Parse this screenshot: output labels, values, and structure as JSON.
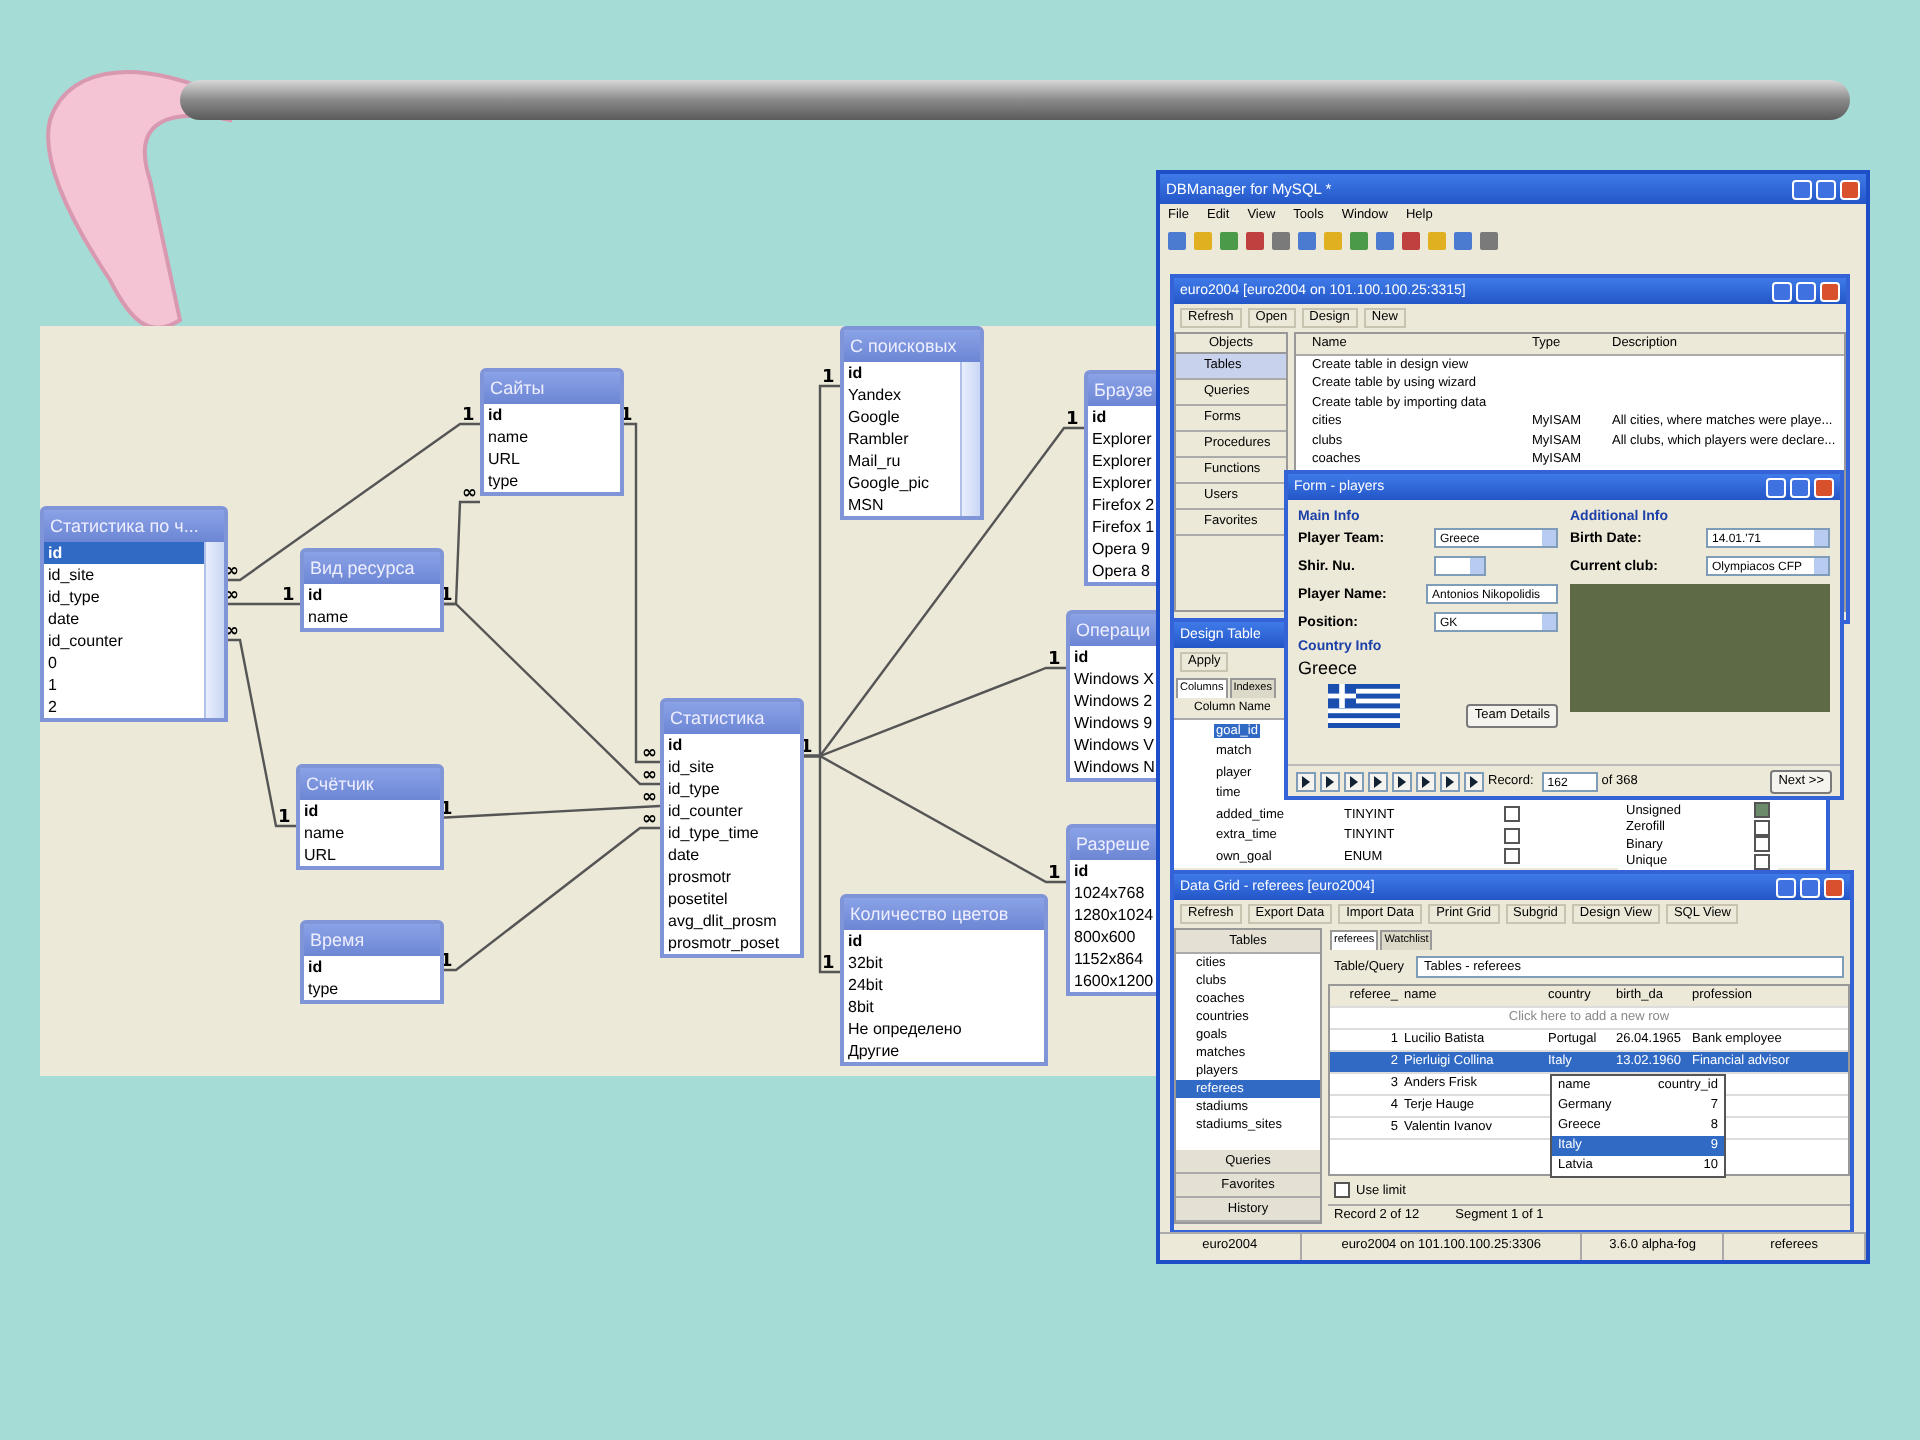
{
  "diagram": {
    "tables": [
      {
        "title": "Статистика по ч...",
        "scrollbar": true,
        "fields": [
          {
            "name": "id",
            "key": true,
            "selected": true
          },
          {
            "name": "id_site",
            "key": false,
            "selected": false
          },
          {
            "name": "id_type",
            "key": false,
            "selected": false
          },
          {
            "name": "date",
            "key": false,
            "selected": false
          },
          {
            "name": "id_counter",
            "key": false,
            "selected": false
          },
          {
            "name": "0",
            "key": false,
            "selected": false
          },
          {
            "name": "1",
            "key": false,
            "selected": false
          },
          {
            "name": "2",
            "key": false,
            "selected": false
          }
        ]
      },
      {
        "title": "Сайты",
        "scrollbar": false,
        "fields": [
          {
            "name": "id",
            "key": true,
            "selected": false
          },
          {
            "name": "name",
            "key": false,
            "selected": false
          },
          {
            "name": "URL",
            "key": false,
            "selected": false
          },
          {
            "name": "type",
            "key": false,
            "selected": false
          }
        ]
      },
      {
        "title": "Вид ресурса",
        "scrollbar": false,
        "fields": [
          {
            "name": "id",
            "key": true,
            "selected": false
          },
          {
            "name": "name",
            "key": false,
            "selected": false
          }
        ]
      },
      {
        "title": "Счётчик",
        "scrollbar": false,
        "fields": [
          {
            "name": "id",
            "key": true,
            "selected": false
          },
          {
            "name": "name",
            "key": false,
            "selected": false
          },
          {
            "name": "URL",
            "key": false,
            "selected": false
          }
        ]
      },
      {
        "title": "Время",
        "scrollbar": false,
        "fields": [
          {
            "name": "id",
            "key": true,
            "selected": false
          },
          {
            "name": "type",
            "key": false,
            "selected": false
          }
        ]
      },
      {
        "title": "Статистика",
        "scrollbar": false,
        "fields": [
          {
            "name": "id",
            "key": true,
            "selected": false
          },
          {
            "name": "id_site",
            "key": false,
            "selected": false
          },
          {
            "name": "id_type",
            "key": false,
            "selected": false
          },
          {
            "name": "id_counter",
            "key": false,
            "selected": false
          },
          {
            "name": "id_type_time",
            "key": false,
            "selected": false
          },
          {
            "name": "date",
            "key": false,
            "selected": false
          },
          {
            "name": "prosmotr",
            "key": false,
            "selected": false
          },
          {
            "name": "posetitel",
            "key": false,
            "selected": false
          },
          {
            "name": "avg_dlit_prosm",
            "key": false,
            "selected": false
          },
          {
            "name": "prosmotr_poset",
            "key": false,
            "selected": false
          }
        ]
      },
      {
        "title": "С поисковых",
        "scrollbar": true,
        "fields": [
          {
            "name": "id",
            "key": true,
            "selected": false
          },
          {
            "name": "Yandex",
            "key": false,
            "selected": false
          },
          {
            "name": "Google",
            "key": false,
            "selected": false
          },
          {
            "name": "Rambler",
            "key": false,
            "selected": false
          },
          {
            "name": "Mail_ru",
            "key": false,
            "selected": false
          },
          {
            "name": "Google_pic",
            "key": false,
            "selected": false
          },
          {
            "name": "MSN",
            "key": false,
            "selected": false
          }
        ]
      },
      {
        "title": "Количество цветов",
        "scrollbar": false,
        "fields": [
          {
            "name": "id",
            "key": true,
            "selected": false
          },
          {
            "name": "32bit",
            "key": false,
            "selected": false
          },
          {
            "name": "24bit",
            "key": false,
            "selected": false
          },
          {
            "name": "8bit",
            "key": false,
            "selected": false
          },
          {
            "name": "Не определено",
            "key": false,
            "selected": false
          },
          {
            "name": "Другие",
            "key": false,
            "selected": false
          }
        ]
      },
      {
        "title": "Браузе",
        "scrollbar": false,
        "fields": [
          {
            "name": "id",
            "key": true,
            "selected": false
          },
          {
            "name": "Explorer",
            "key": false,
            "selected": false
          },
          {
            "name": "Explorer",
            "key": false,
            "selected": false
          },
          {
            "name": "Explorer",
            "key": false,
            "selected": false
          },
          {
            "name": "Firefox 2",
            "key": false,
            "selected": false
          },
          {
            "name": "Firefox 1",
            "key": false,
            "selected": false
          },
          {
            "name": "Opera 9",
            "key": false,
            "selected": false
          },
          {
            "name": "Opera 8",
            "key": false,
            "selected": false
          }
        ]
      },
      {
        "title": "Операци",
        "scrollbar": false,
        "fields": [
          {
            "name": "id",
            "key": true,
            "selected": false
          },
          {
            "name": "Windows X",
            "key": false,
            "selected": false
          },
          {
            "name": "Windows 2",
            "key": false,
            "selected": false
          },
          {
            "name": "Windows 9",
            "key": false,
            "selected": false
          },
          {
            "name": "Windows V",
            "key": false,
            "selected": false
          },
          {
            "name": "Windows N",
            "key": false,
            "selected": false
          }
        ]
      },
      {
        "title": "Разреше",
        "scrollbar": false,
        "fields": [
          {
            "name": "id",
            "key": true,
            "selected": false
          },
          {
            "name": "1024x768",
            "key": false,
            "selected": false
          },
          {
            "name": "1280x1024",
            "key": false,
            "selected": false
          },
          {
            "name": "800x600",
            "key": false,
            "selected": false
          },
          {
            "name": "1152x864",
            "key": false,
            "selected": false
          },
          {
            "name": "1600x1200",
            "key": false,
            "selected": false
          }
        ]
      }
    ],
    "relationships": [
      {
        "from_label": "∞",
        "to_label": "1"
      },
      {
        "from_label": "∞",
        "to_label": "1"
      },
      {
        "from_label": "∞",
        "to_label": "1"
      },
      {
        "from_label": "1",
        "to_label": "∞"
      },
      {
        "from_label": "1",
        "to_label": "∞"
      },
      {
        "to_label": "∞"
      },
      {
        "from_label": "1",
        "to_label": "∞"
      },
      {
        "from_label": "1",
        "to_label": "∞"
      },
      {
        "from_label": "1",
        "to_label": "1"
      },
      {
        "to_label": "1"
      },
      {
        "to_label": "1"
      },
      {
        "to_label": "1"
      },
      {
        "to_label": "1"
      }
    ]
  },
  "app_window": {
    "title": "DBManager for MySQL *",
    "menu": [
      "File",
      "Edit",
      "View",
      "Tools",
      "Window",
      "Help"
    ],
    "status_bar": [
      "euro2004",
      "euro2004 on 101.100.100.25:3306",
      "3.6.0 alpha-fog",
      "referees"
    ]
  },
  "explorer_window": {
    "title": "euro2004 [euro2004 on 101.100.100.25:3315]",
    "toolbar": [
      "Refresh",
      "Open",
      "Design",
      "New"
    ],
    "objects_header": "Objects",
    "objects": [
      {
        "label": "Tables",
        "selected": true
      },
      {
        "label": "Queries",
        "selected": false
      },
      {
        "label": "Forms",
        "selected": false
      },
      {
        "label": "Procedures",
        "selected": false
      },
      {
        "label": "Functions",
        "selected": false
      },
      {
        "label": "Users",
        "selected": false
      },
      {
        "label": "Favorites",
        "selected": false
      }
    ],
    "columns": [
      "Name",
      "Type",
      "Description"
    ],
    "rows": [
      {
        "name": "Create table in design view"
      },
      {
        "name": "Create table by using wizard"
      },
      {
        "name": "Create table by importing data"
      },
      {
        "name": "cities",
        "type": "MyISAM",
        "description": "All cities, where matches were playe..."
      },
      {
        "name": "clubs",
        "type": "MyISAM",
        "description": "All clubs, which players were declare..."
      },
      {
        "name": "coaches",
        "type": "MyISAM"
      }
    ]
  },
  "design_window": {
    "title": "Design Table",
    "toolbar": [
      "Apply"
    ],
    "tabs": [
      {
        "label": "Columns",
        "selected": true
      },
      {
        "label": "Indexes",
        "selected": false
      }
    ],
    "column_header": "Column Name",
    "rows": [
      {
        "name": "goal_id",
        "selected": true
      },
      {
        "name": "match",
        "selected": false
      },
      {
        "name": "player",
        "selected": false
      },
      {
        "name": "time",
        "selected": false
      },
      {
        "name": "added_time",
        "selected": false,
        "type": "TINYINT",
        "checked": false
      },
      {
        "name": "extra_time",
        "selected": false,
        "type": "TINYINT",
        "checked": false
      },
      {
        "name": "own_goal",
        "selected": false,
        "type": "ENUM",
        "checked": false
      }
    ],
    "properties": [
      {
        "label": "Unsigned",
        "checked": true
      },
      {
        "label": "Zerofill",
        "checked": false
      },
      {
        "label": "Binary",
        "checked": false
      },
      {
        "label": "Unique",
        "checked": false
      }
    ]
  },
  "form_window": {
    "title": "Form - players",
    "main_heading": "Main Info",
    "main_fields": [
      {
        "label": "Player Team:",
        "value": "Greece",
        "kind": "dropdown"
      },
      {
        "label": "Shir. Nu.",
        "kind": "spinner"
      },
      {
        "label": "Player Name:",
        "value": "Antonios Nikopolidis",
        "kind": "text"
      },
      {
        "label": "Position:",
        "value": "GK",
        "kind": "dropdown"
      }
    ],
    "additional_heading": "Additional Info",
    "additional_fields": [
      {
        "label": "Birth Date:",
        "value": "14.01.'71",
        "kind": "dropdown"
      },
      {
        "label": "Current club:",
        "value": "Olympiacos CFP",
        "kind": "dropdown"
      }
    ],
    "country_heading": "Country Info",
    "country": "Greece",
    "team_button": "Team Details",
    "record_label": "Record:",
    "record_value": "162",
    "record_total": "of 368",
    "next_button": "Next >>"
  },
  "grid_window": {
    "title": "Data Grid - referees [euro2004]",
    "toolbar": [
      "Refresh",
      "Export Data",
      "Import Data",
      "Print Grid",
      "Subgrid",
      "Design View",
      "SQL View"
    ],
    "nav_header": "Tables",
    "tables": [
      {
        "label": "cities",
        "selected": false
      },
      {
        "label": "clubs",
        "selected": false
      },
      {
        "label": "coaches",
        "selected": false
      },
      {
        "label": "countries",
        "selected": false
      },
      {
        "label": "goals",
        "selected": false
      },
      {
        "label": "matches",
        "selected": false
      },
      {
        "label": "players",
        "selected": false
      },
      {
        "label": "referees",
        "selected": true
      },
      {
        "label": "stadiums",
        "selected": false
      },
      {
        "label": "stadiums_sites",
        "selected": false
      }
    ],
    "nav_sections": [
      "Queries",
      "Favorites",
      "History"
    ],
    "tabs": [
      {
        "label": "referees",
        "selected": true
      },
      {
        "label": "Watchlist",
        "selected": false
      }
    ],
    "table_query_label": "Table/Query",
    "table_query_value": "Tables - referees",
    "columns": [
      "referee_",
      "name",
      "country",
      "birth_da",
      "profession"
    ],
    "add_row_hint": "Click here to add a new row",
    "rows": [
      {
        "cells": [
          "1",
          "Lucilio Batista",
          "Portugal",
          "26.04.1965",
          "Bank employee"
        ],
        "selected": false
      },
      {
        "cells": [
          "2",
          "Pierluigi Collina",
          "Italy",
          "13.02.1960",
          "Financial advisor"
        ],
        "selected": true
      },
      {
        "cells": [
          "3",
          "Anders Frisk"
        ],
        "selected": false
      },
      {
        "cells": [
          "4",
          "Terje Hauge"
        ],
        "selected": false
      },
      {
        "cells": [
          "5",
          "Valentin Ivanov"
        ],
        "selected": false
      }
    ],
    "dropdown": [
      {
        "name": "name",
        "id": "country_id",
        "selected": false
      },
      {
        "name": "Germany",
        "id": "7",
        "selected": false
      },
      {
        "name": "Greece",
        "id": "8",
        "selected": false
      },
      {
        "name": "Italy",
        "id": "9",
        "selected": true
      },
      {
        "name": "Latvia",
        "id": "10",
        "selected": false
      }
    ],
    "limit_label": "Use limit",
    "limit_checked": false,
    "status": [
      "Record 2 of 12",
      "Segment 1 of 1"
    ]
  }
}
